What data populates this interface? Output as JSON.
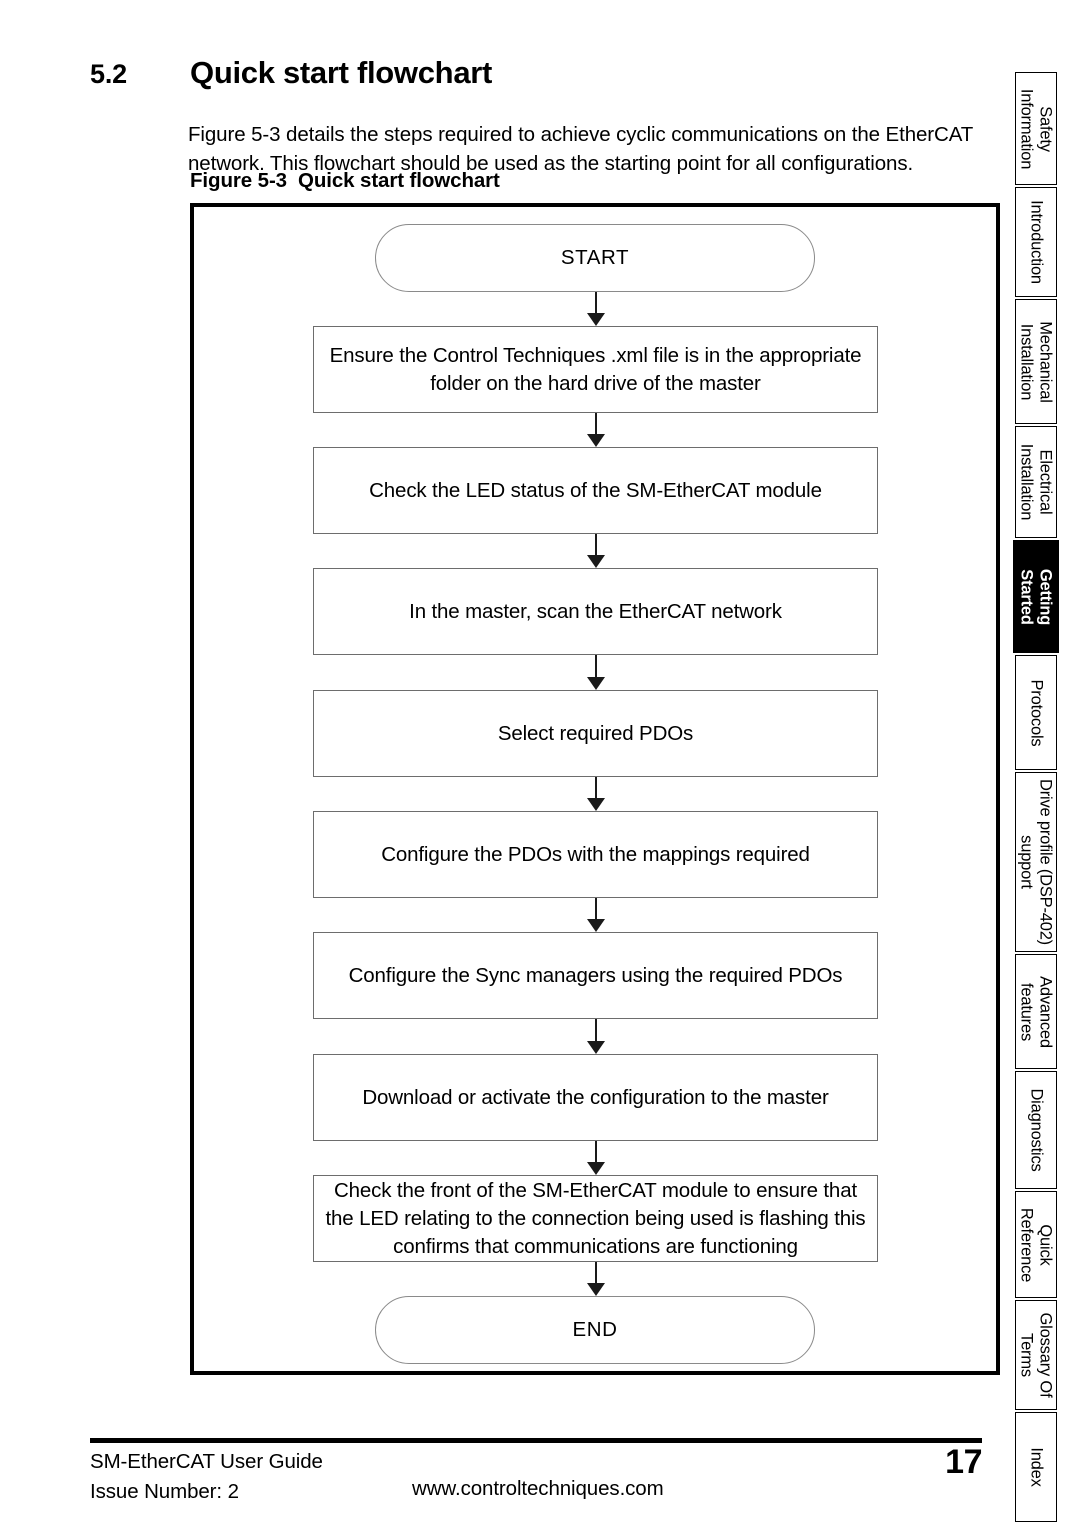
{
  "section": {
    "number": "5.2",
    "title": "Quick start flowchart",
    "intro": "Figure 5-3 details the steps required to achieve cyclic communications on the EtherCAT network. This flowchart should be used as the starting point for all configurations."
  },
  "figure": {
    "number": "Figure 5-3",
    "title": "Quick start flowchart"
  },
  "flowchart": {
    "nodes": [
      {
        "id": "start",
        "type": "terminator",
        "label": "START"
      },
      {
        "id": "step1",
        "type": "process",
        "label": "Ensure the Control Techniques .xml file is in the appropriate folder on the hard drive of the master"
      },
      {
        "id": "step2",
        "type": "process",
        "label": "Check the LED status of the SM-EtherCAT module"
      },
      {
        "id": "step3",
        "type": "process",
        "label": "In the master, scan the EtherCAT network"
      },
      {
        "id": "step4",
        "type": "process",
        "label": "Select required PDOs"
      },
      {
        "id": "step5",
        "type": "process",
        "label": "Configure the PDOs with the mappings required"
      },
      {
        "id": "step6",
        "type": "process",
        "label": "Configure the Sync managers using the required  PDOs"
      },
      {
        "id": "step7",
        "type": "process",
        "label": "Download or activate the configuration to the master"
      },
      {
        "id": "step8",
        "type": "process",
        "label": "Check the front of the SM-EtherCAT module to ensure that the LED relating to the connection being used is flashing this confirms that communications are functioning"
      },
      {
        "id": "end",
        "type": "terminator",
        "label": "END"
      }
    ]
  },
  "tabs": [
    {
      "label": "Safety Information",
      "active": false
    },
    {
      "label": "Introduction",
      "active": false
    },
    {
      "label": "Mechanical Installation",
      "active": false
    },
    {
      "label": "Electrical Installation",
      "active": false
    },
    {
      "label": "Getting Started",
      "active": true
    },
    {
      "label": "Protocols",
      "active": false
    },
    {
      "label": "Drive profile (DSP-402) support",
      "active": false
    },
    {
      "label": "Advanced features",
      "active": false
    },
    {
      "label": "Diagnostics",
      "active": false
    },
    {
      "label": "Quick Reference",
      "active": false
    },
    {
      "label": "Glossary Of Terms",
      "active": false
    },
    {
      "label": "Index",
      "active": false
    }
  ],
  "footer": {
    "guide": "SM-EtherCAT User Guide",
    "issue": "Issue Number:  2",
    "url": "www.controltechniques.com",
    "page": "17"
  }
}
